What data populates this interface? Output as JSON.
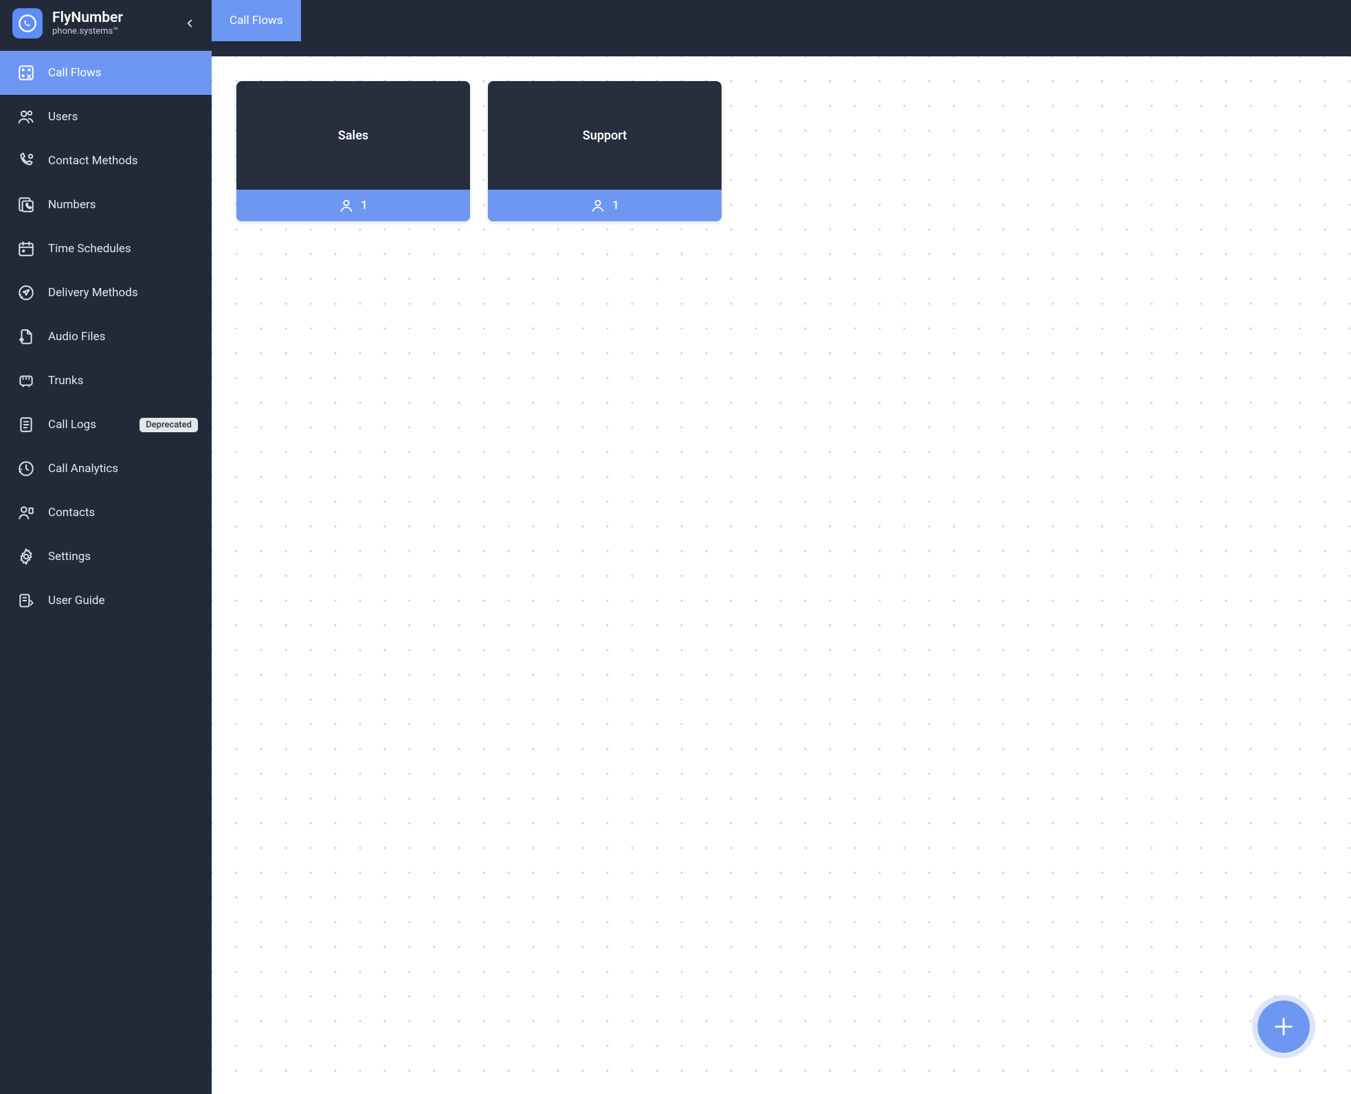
{
  "brand": {
    "title": "FlyNumber",
    "subtitle": "phone.systems™"
  },
  "tab": {
    "label": "Call Flows"
  },
  "sidebar": {
    "items": [
      {
        "label": "Call Flows",
        "icon": "call-flows",
        "active": true
      },
      {
        "label": "Users",
        "icon": "users"
      },
      {
        "label": "Contact Methods",
        "icon": "contact-methods"
      },
      {
        "label": "Numbers",
        "icon": "numbers"
      },
      {
        "label": "Time Schedules",
        "icon": "time-schedules"
      },
      {
        "label": "Delivery Methods",
        "icon": "delivery-methods"
      },
      {
        "label": "Audio Files",
        "icon": "audio-files"
      },
      {
        "label": "Trunks",
        "icon": "trunks"
      },
      {
        "label": "Call Logs",
        "icon": "call-logs",
        "badge": "Deprecated"
      },
      {
        "label": "Call Analytics",
        "icon": "call-analytics"
      },
      {
        "label": "Contacts",
        "icon": "contacts"
      },
      {
        "label": "Settings",
        "icon": "settings"
      },
      {
        "label": "User Guide",
        "icon": "user-guide"
      }
    ]
  },
  "cards": [
    {
      "title": "Sales",
      "count": "1"
    },
    {
      "title": "Support",
      "count": "1"
    }
  ]
}
